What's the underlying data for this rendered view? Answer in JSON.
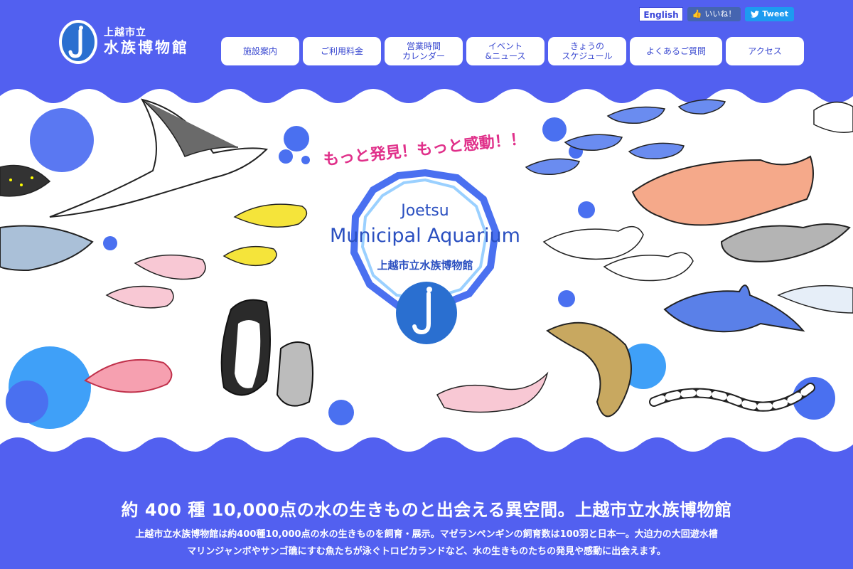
{
  "logo": {
    "sub": "上越市立",
    "main": "水族博物館"
  },
  "utility": {
    "english": "English",
    "like": "いいね！",
    "tweet": "Tweet"
  },
  "nav": [
    {
      "label": "施設案内",
      "name": "nav-facility-guide"
    },
    {
      "label": "ご利用料金",
      "name": "nav-admission-fees"
    },
    {
      "label": "営業時間\nカレンダー",
      "name": "nav-hours-calendar"
    },
    {
      "label": "イベント\n&ニュース",
      "name": "nav-events-news"
    },
    {
      "label": "きょうの\nスケジュール",
      "name": "nav-today-schedule"
    },
    {
      "label": "よくあるご質問",
      "name": "nav-faq"
    },
    {
      "label": "アクセス",
      "name": "nav-access"
    }
  ],
  "hero": {
    "tagline": "もっと発見！もっと感動！！",
    "title_line1": "Joetsu",
    "title_line2": "Municipal Aquarium",
    "title_ja": "上越市立水族博物館"
  },
  "intro": {
    "headline": "約 400 種 10,000点の水の生きものと出会える異空間。上越市立水族博物館",
    "line1": "上越市立水族博物館は約400種10,000点の水の生きものを飼育・展示。マゼランペンギンの飼育数は100羽と日本一。大迫力の大回遊水槽",
    "line2": "マリンジャンボやサンゴ礁にすむ魚たちが泳ぐトロピカランドなど、水の生きものたちの発見や感動に出会えます。"
  },
  "colors": {
    "brand_blue": "#5260f0",
    "deep_blue": "#2a4fc0",
    "bubble_blue": "#4a70f0",
    "tagline_pink": "#e0308a"
  }
}
